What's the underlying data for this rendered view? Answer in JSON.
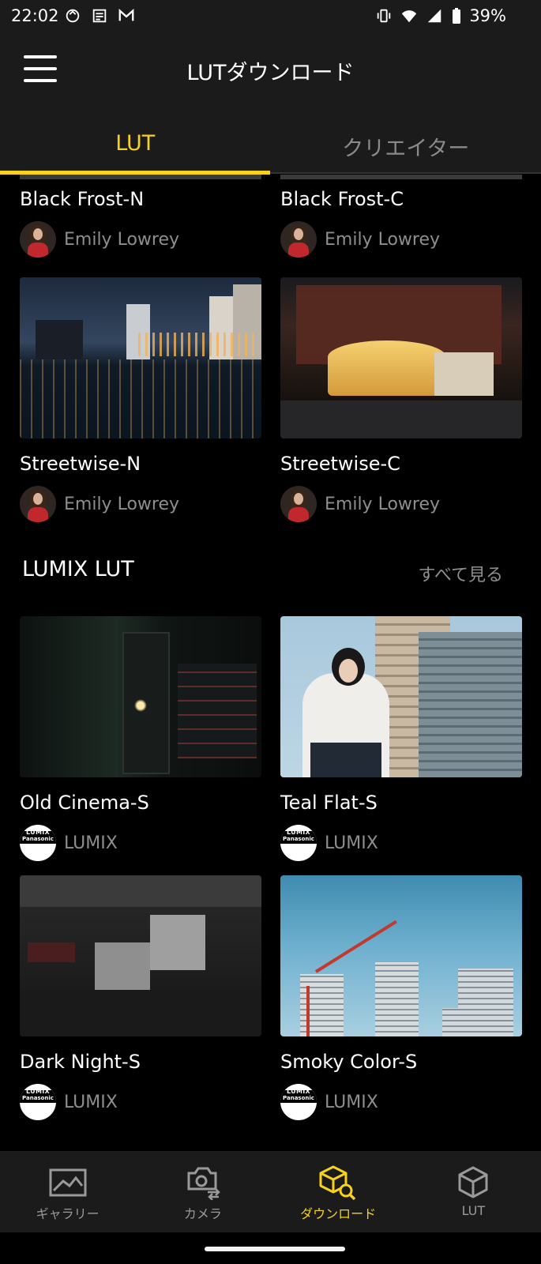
{
  "status_bar": {
    "time": "22:02",
    "battery": "39%",
    "icons": [
      "sync-icon",
      "news-icon",
      "mail-icon",
      "vibrate-icon",
      "wifi-icon",
      "signal-icon",
      "battery-icon"
    ]
  },
  "app_bar": {
    "title": "LUTダウンロード",
    "menu_icon": "hamburger-menu-icon"
  },
  "tabs": [
    {
      "label": "LUT",
      "active": true
    },
    {
      "label": "クリエイター",
      "active": false
    }
  ],
  "creator_luts": [
    {
      "title": "Black Frost-N",
      "author": "Emily Lowrey"
    },
    {
      "title": "Black Frost-C",
      "author": "Emily Lowrey"
    },
    {
      "title": "Streetwise-N",
      "author": "Emily Lowrey"
    },
    {
      "title": "Streetwise-C",
      "author": "Emily Lowrey"
    }
  ],
  "lumix_section": {
    "title": "LUMIX LUT",
    "see_all": "すべて見る",
    "logo_text_top": "LUMIX",
    "logo_text_bottom": "Panasonic",
    "items": [
      {
        "title": "Old Cinema-S",
        "author": "LUMIX"
      },
      {
        "title": "Teal Flat-S",
        "author": "LUMIX"
      },
      {
        "title": "Dark Night-S",
        "author": "LUMIX"
      },
      {
        "title": "Smoky Color-S",
        "author": "LUMIX"
      }
    ]
  },
  "bottom_nav": [
    {
      "label": "ギャラリー",
      "icon": "gallery-icon",
      "active": false
    },
    {
      "label": "カメラ",
      "icon": "camera-transfer-icon",
      "active": false
    },
    {
      "label": "ダウンロード",
      "icon": "cube-search-icon",
      "active": true
    },
    {
      "label": "LUT",
      "icon": "cube-icon",
      "active": false
    }
  ],
  "colors": {
    "accent": "#f7d21c",
    "bar_background": "#1b1b1b",
    "content_background": "#000000",
    "secondary_text": "#8e8e8e"
  }
}
